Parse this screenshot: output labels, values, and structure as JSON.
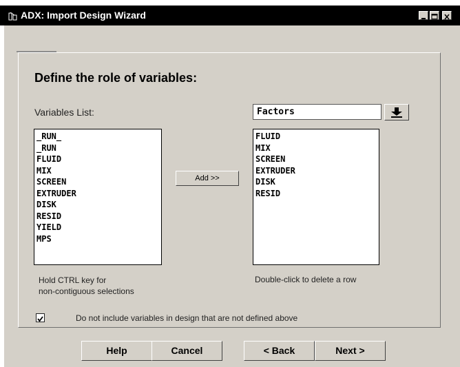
{
  "window": {
    "title": "ADX: Import Design Wizard",
    "icon": "application-icon",
    "controls": [
      "minimize-icon",
      "maximize-icon",
      "close-icon"
    ]
  },
  "page": {
    "heading": "Define the role of variables:"
  },
  "variables_list": {
    "label": "Variables List:",
    "items": [
      "_RUN_",
      "_RUN",
      "FLUID",
      "MIX",
      "SCREEN",
      "EXTRUDER",
      "DISK",
      "RESID",
      "YIELD",
      "MPS"
    ],
    "hint_line1": "Hold CTRL key for",
    "hint_line2": "non-contiguous selections"
  },
  "add_button": {
    "label": "Add >>"
  },
  "role": {
    "selected": "Factors",
    "dropdown_icon": "dropdown-arrow-icon"
  },
  "role_list": {
    "items": [
      "FLUID",
      "MIX",
      "SCREEN",
      "EXTRUDER",
      "DISK",
      "RESID"
    ],
    "hint": "Double-click to delete a row"
  },
  "option": {
    "checked": true,
    "label": "Do not include variables in design that are not defined above"
  },
  "footer": {
    "help": "Help",
    "cancel": "Cancel",
    "back": "< Back",
    "next": "Next >"
  },
  "colors": {
    "titlebar": "#000000",
    "dialog_bg": "#d4d0c8",
    "list_bg": "#ffffff"
  }
}
